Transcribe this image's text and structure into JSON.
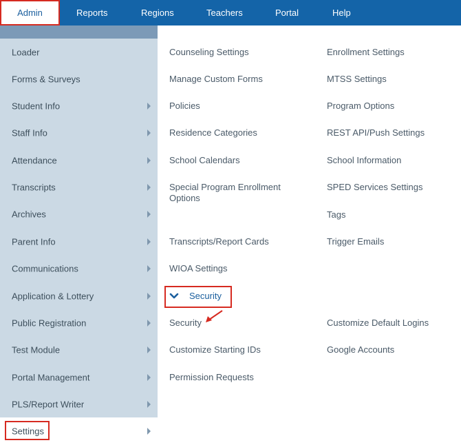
{
  "topnav": {
    "items": [
      {
        "label": "Admin",
        "active": true
      },
      {
        "label": "Reports"
      },
      {
        "label": "Regions"
      },
      {
        "label": "Teachers"
      },
      {
        "label": "Portal"
      },
      {
        "label": "Help"
      }
    ]
  },
  "sidebar": {
    "items": [
      {
        "label": "Loader",
        "has_arrow": false
      },
      {
        "label": "Forms & Surveys",
        "has_arrow": false
      },
      {
        "label": "Student Info",
        "has_arrow": true
      },
      {
        "label": "Staff Info",
        "has_arrow": true
      },
      {
        "label": "Attendance",
        "has_arrow": true
      },
      {
        "label": "Transcripts",
        "has_arrow": true
      },
      {
        "label": "Archives",
        "has_arrow": true
      },
      {
        "label": "Parent Info",
        "has_arrow": true
      },
      {
        "label": "Communications",
        "has_arrow": true
      },
      {
        "label": "Application & Lottery",
        "has_arrow": true
      },
      {
        "label": "Public Registration",
        "has_arrow": true
      },
      {
        "label": "Test Module",
        "has_arrow": true
      },
      {
        "label": "Portal Management",
        "has_arrow": true
      },
      {
        "label": "PLS/Report Writer",
        "has_arrow": true
      },
      {
        "label": "Settings",
        "has_arrow": true,
        "selected": true
      }
    ]
  },
  "content": {
    "left_column": [
      "Counseling Settings",
      "Manage Custom Forms",
      "Policies",
      "Residence Categories",
      "School Calendars",
      "Special Program Enrollment Options",
      "Transcripts/Report Cards",
      "WIOA Settings"
    ],
    "right_column": [
      "Enrollment Settings",
      "MTSS Settings",
      "Program Options",
      "REST API/Push Settings",
      "School Information",
      "SPED Services Settings",
      "Tags",
      "Trigger Emails"
    ],
    "security_section": {
      "title": "Security",
      "left_items": [
        "Security",
        "Customize Starting IDs",
        "Permission Requests"
      ],
      "right_items": [
        "Customize Default Logins",
        "Google Accounts"
      ]
    }
  },
  "colors": {
    "nav_bg": "#1464a8",
    "sidebar_bg": "#cbd9e4",
    "sidebar_top": "#7c9ab7",
    "accent": "#1b5f9e",
    "highlight": "#d62a20"
  }
}
